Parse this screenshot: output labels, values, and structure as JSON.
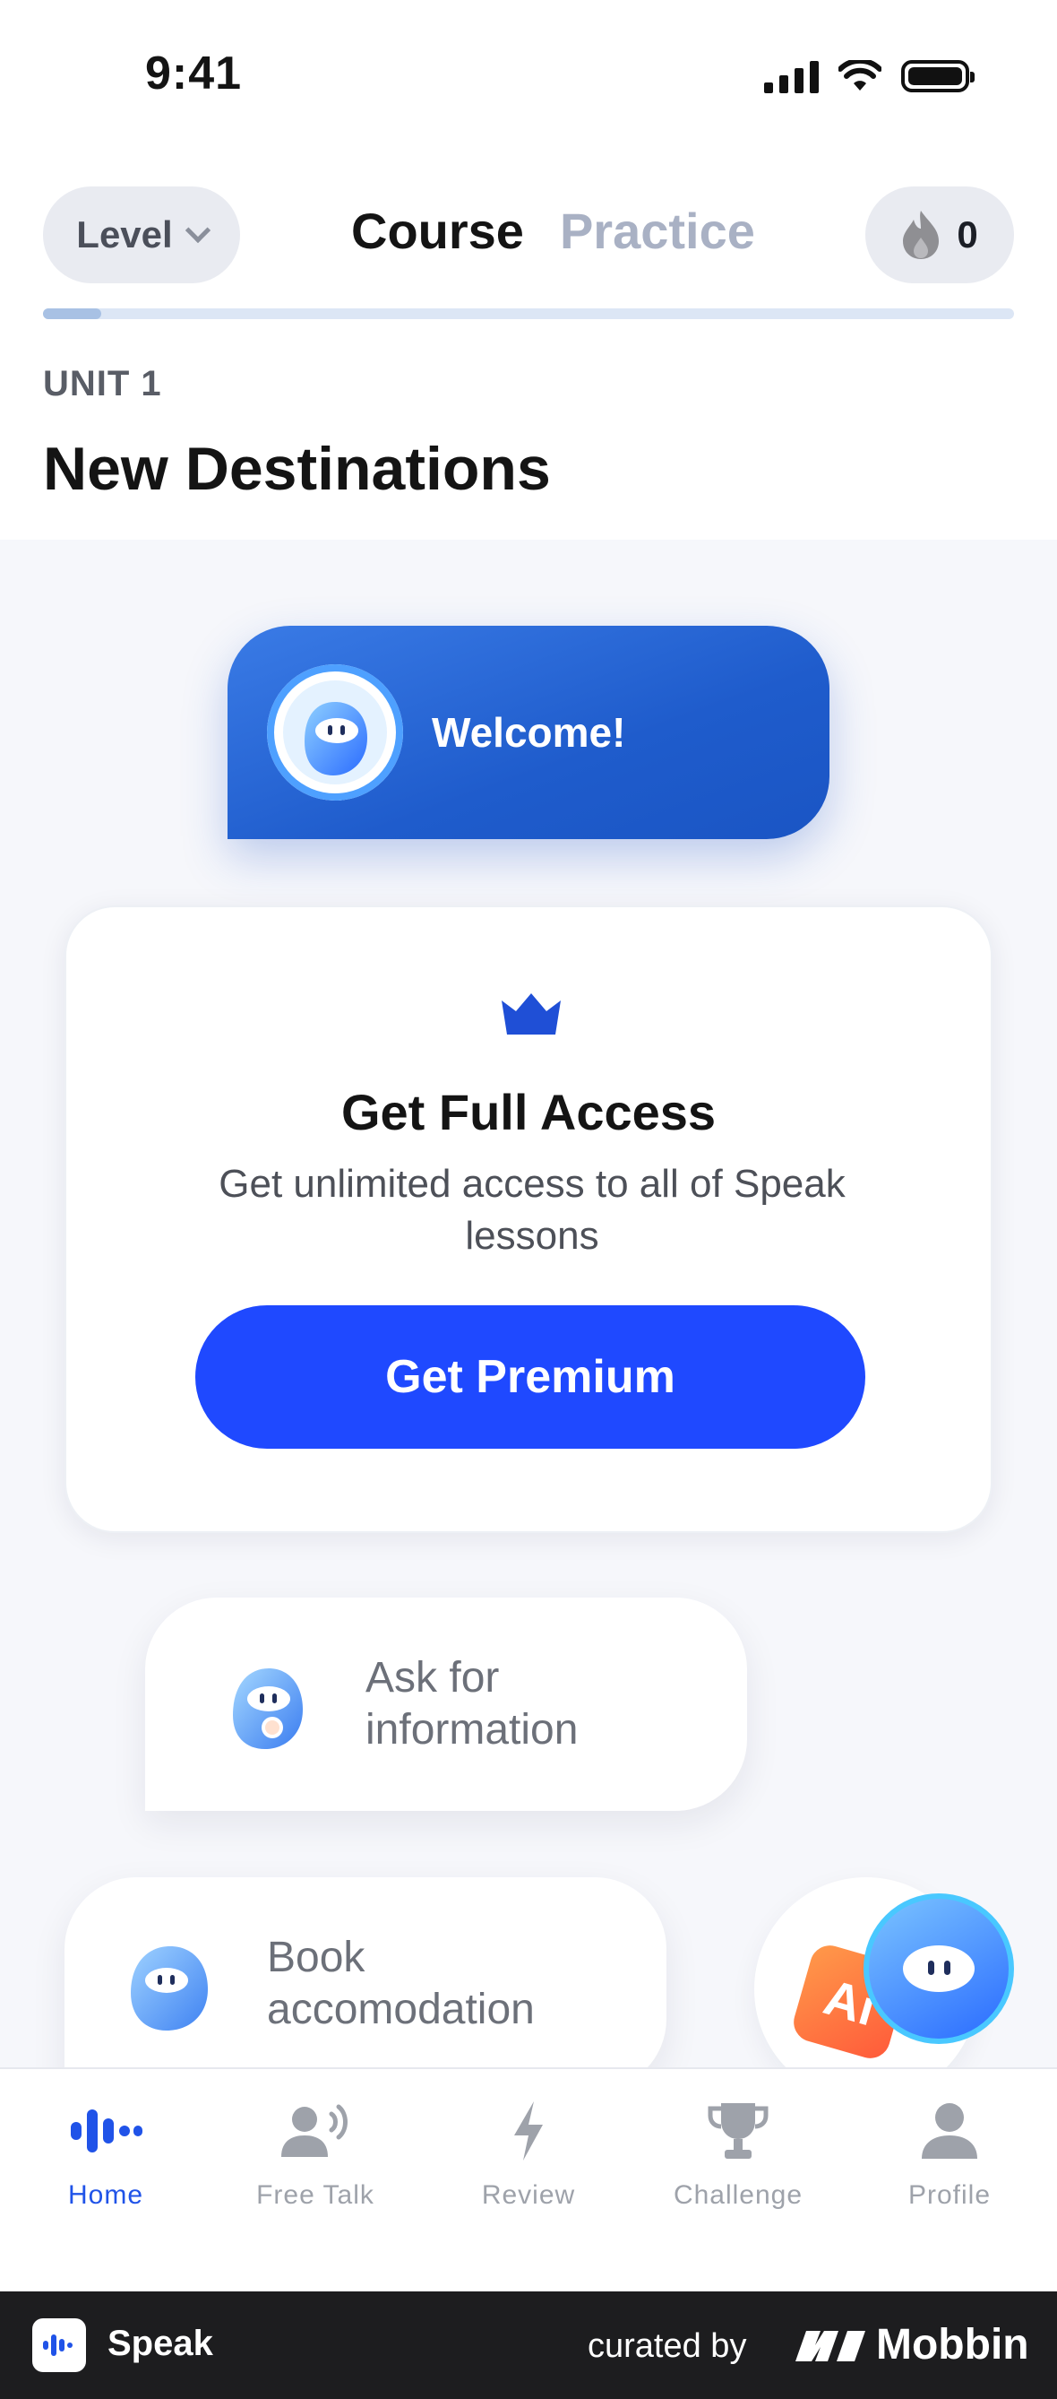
{
  "status_bar": {
    "time": "9:41"
  },
  "header": {
    "level_label": "Level",
    "tabs": [
      {
        "label": "Course"
      },
      {
        "label": "Practice"
      }
    ],
    "streak_count": "0",
    "progress_fraction": 0.06
  },
  "unit": {
    "label": "UNIT 1",
    "title": "New Destinations"
  },
  "lessons": {
    "welcome": "Welcome!",
    "premium": {
      "title": "Get Full Access",
      "subtitle": "Get unlimited access to all of Speak lessons",
      "button": "Get Premium"
    },
    "ask": "Ask for information",
    "book": "Book accomodation",
    "ai_badge": "Ai"
  },
  "tab_bar": {
    "items": [
      {
        "label": "Home",
        "icon": "home-icon",
        "active": true
      },
      {
        "label": "Free Talk",
        "icon": "free-talk-icon",
        "active": false
      },
      {
        "label": "Review",
        "icon": "lightning-icon",
        "active": false
      },
      {
        "label": "Challenge",
        "icon": "trophy-icon",
        "active": false
      },
      {
        "label": "Profile",
        "icon": "profile-icon",
        "active": false
      }
    ]
  },
  "footer": {
    "app_name": "Speak",
    "curated_by": "curated by",
    "brand": "Mobbin"
  },
  "colors": {
    "accent": "#1f49ff",
    "welcome_card": "#2a66d6",
    "active_tab": "#2053e8",
    "inactive": "#a9b1c4"
  }
}
